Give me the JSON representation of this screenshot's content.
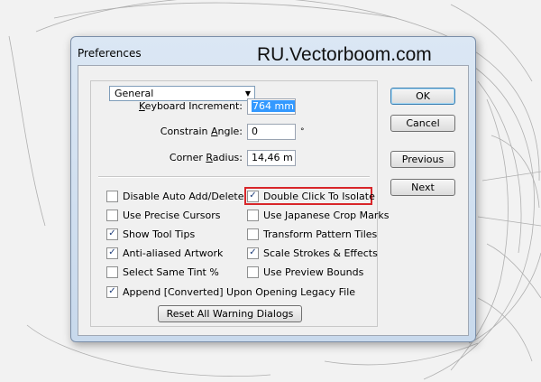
{
  "watermark": "RU.Vectorboom.com",
  "dialog": {
    "title": "Preferences"
  },
  "category_select": {
    "value": "General"
  },
  "fields": {
    "keyboard_increment": {
      "label_pre": "",
      "label_u": "K",
      "label_post": "eyboard Increment:",
      "value": "764 mm"
    },
    "constrain_angle": {
      "label_pre": "Constrain ",
      "label_u": "A",
      "label_post": "ngle:",
      "value": "0"
    },
    "corner_radius": {
      "label_pre": "Corner ",
      "label_u": "R",
      "label_post": "adius:",
      "value": "14,46 m"
    }
  },
  "degree_symbol": "°",
  "checkboxes_left": [
    {
      "label": "Disable Auto Add/Delete",
      "checked": false
    },
    {
      "label": "Use Precise Cursors",
      "checked": false
    },
    {
      "label": "Show Tool Tips",
      "checked": true
    },
    {
      "label": "Anti-aliased Artwork",
      "checked": true
    },
    {
      "label": "Select Same Tint %",
      "checked": false
    }
  ],
  "checkboxes_right": [
    {
      "label": "Double Click To Isolate",
      "checked": true
    },
    {
      "label": "Use Japanese Crop Marks",
      "checked": false
    },
    {
      "label": "Transform Pattern Tiles",
      "checked": false
    },
    {
      "label": "Scale Strokes & Effects",
      "checked": true
    },
    {
      "label": "Use Preview Bounds",
      "checked": false
    }
  ],
  "checkbox_append": {
    "label": "Append [Converted] Upon Opening Legacy File",
    "checked": true
  },
  "buttons": {
    "reset": "Reset All Warning Dialogs",
    "ok": "OK",
    "cancel": "Cancel",
    "previous": "Previous",
    "next": "Next"
  },
  "colors": {
    "highlight": "#d8262a",
    "selection": "#3399ff"
  }
}
